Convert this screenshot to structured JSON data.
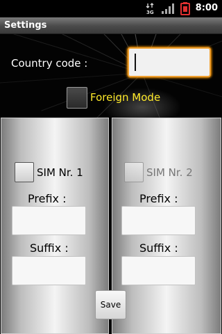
{
  "status_bar": {
    "time": "8:00",
    "network_label": "3G",
    "icons": [
      "network-3g-icon",
      "signal-icon",
      "battery-icon"
    ],
    "battery_color": "#e03030"
  },
  "title_bar": {
    "title": "Settings"
  },
  "country": {
    "label": "Country code :",
    "value": "",
    "focus_color": "#ff9a00"
  },
  "foreign_mode": {
    "label": "Foreign Mode",
    "checked": false,
    "label_color": "#ffea2a"
  },
  "sims": [
    {
      "label": "SIM Nr. 1",
      "checked": false,
      "enabled": true,
      "prefix_label": "Prefix :",
      "prefix_value": "",
      "suffix_label": "Suffix :",
      "suffix_value": ""
    },
    {
      "label": "SIM Nr. 2",
      "checked": false,
      "enabled": false,
      "prefix_label": "Prefix :",
      "prefix_value": "",
      "suffix_label": "Suffix :",
      "suffix_value": ""
    }
  ],
  "save_label": "Save"
}
